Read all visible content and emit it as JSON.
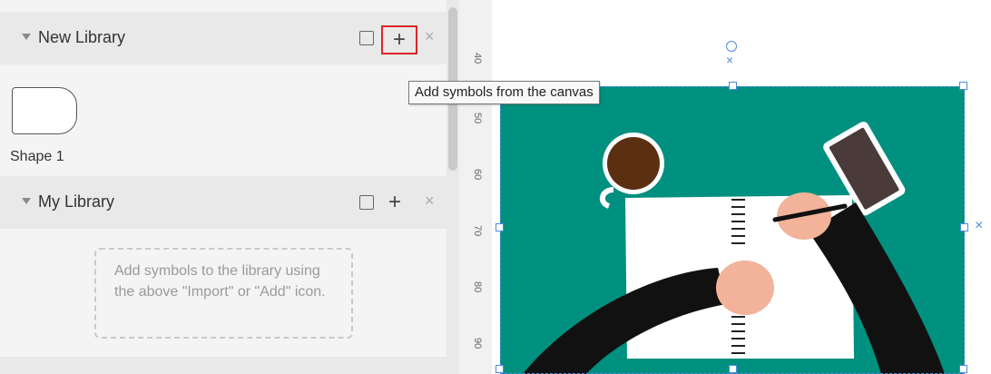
{
  "libraries": [
    {
      "title": "New Library",
      "shapes": [
        {
          "label": "Shape 1"
        }
      ]
    },
    {
      "title": "My Library",
      "empty_hint": "Add symbols to the library using the above \"Import\" or \"Add\" icon."
    }
  ],
  "tooltip": "Add symbols from the canvas",
  "ruler": {
    "ticks": [
      "40",
      "50",
      "60",
      "70",
      "80",
      "90"
    ]
  },
  "colors": {
    "accent_highlight": "#d9252b",
    "image_background": "#00907f",
    "selection_handle": "#4f8ae0"
  },
  "icons": {
    "section_toggle": "triangle-down-icon",
    "import": "import-icon",
    "add": "plus-icon",
    "close": "close-icon"
  }
}
